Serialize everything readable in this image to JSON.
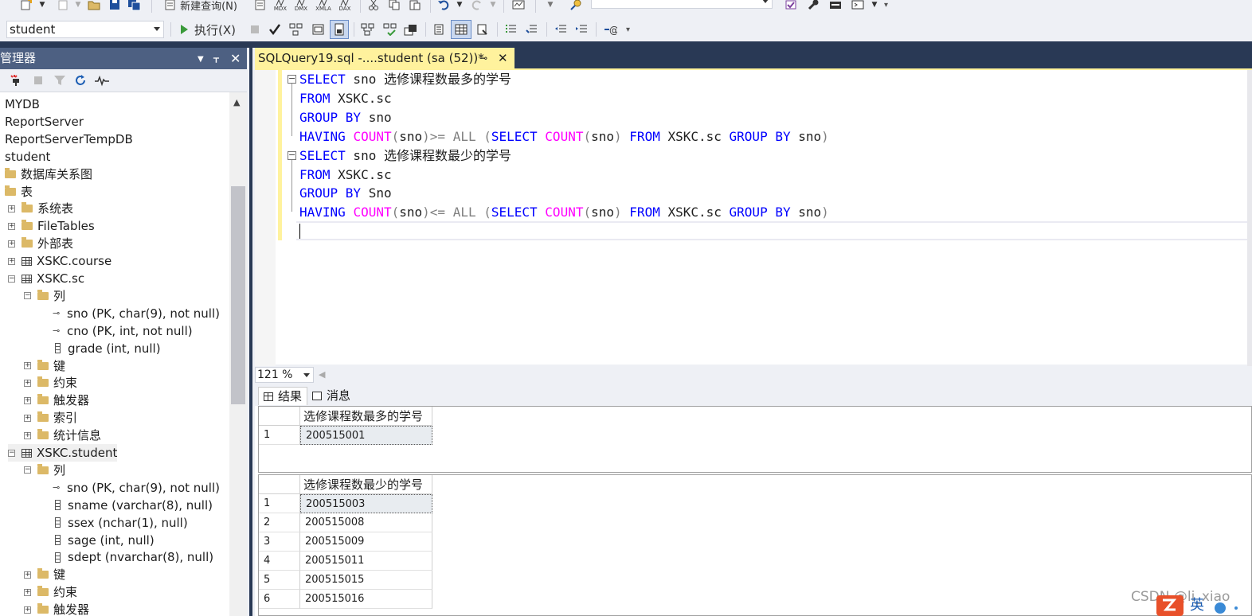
{
  "toolbar1": {
    "new_query_label": "新建查询(N)",
    "mdx": "MDX",
    "dmx": "DMX",
    "xmla": "XMLA",
    "dax": "DAX"
  },
  "toolbar2": {
    "database": "student",
    "execute_label": "执行(X)"
  },
  "object_explorer": {
    "title": "管理器",
    "tree": [
      {
        "label": "MYDB"
      },
      {
        "label": "ReportServer"
      },
      {
        "label": "ReportServerTempDB"
      },
      {
        "label": "student"
      },
      {
        "label": "数据库关系图"
      },
      {
        "label": "表"
      },
      {
        "label": "系统表"
      },
      {
        "label": "FileTables"
      },
      {
        "label": "外部表"
      },
      {
        "label": "XSKC.course"
      },
      {
        "label": "XSKC.sc"
      },
      {
        "label": "列"
      },
      {
        "label": "sno (PK, char(9), not null)"
      },
      {
        "label": "cno (PK, int, not null)"
      },
      {
        "label": "grade (int, null)"
      },
      {
        "label": "键"
      },
      {
        "label": "约束"
      },
      {
        "label": "触发器"
      },
      {
        "label": "索引"
      },
      {
        "label": "统计信息"
      },
      {
        "label": "XSKC.student"
      },
      {
        "label": "列"
      },
      {
        "label": "sno (PK, char(9), not null)"
      },
      {
        "label": "sname (varchar(8), null)"
      },
      {
        "label": "ssex (nchar(1), null)"
      },
      {
        "label": "sage (int, null)"
      },
      {
        "label": "sdept (nvarchar(8), null)"
      },
      {
        "label": "键"
      },
      {
        "label": "约束"
      },
      {
        "label": "触发器"
      }
    ]
  },
  "editor": {
    "tab_title": "SQLQuery19.sql -....student (sa (52))*",
    "lines": [
      [
        {
          "t": "SELECT",
          "c": "kw"
        },
        {
          "t": " sno 选修课程数最多的学号",
          "c": ""
        }
      ],
      [
        {
          "t": "FROM",
          "c": "kw"
        },
        {
          "t": " XSKC.sc",
          "c": ""
        }
      ],
      [
        {
          "t": "GROUP BY",
          "c": "kw"
        },
        {
          "t": " sno",
          "c": ""
        }
      ],
      [
        {
          "t": "HAVING",
          "c": "kw"
        },
        {
          "t": " ",
          "c": ""
        },
        {
          "t": "COUNT",
          "c": "fn"
        },
        {
          "t": "(",
          "c": "gr"
        },
        {
          "t": "sno",
          "c": ""
        },
        {
          "t": ")>= ALL (",
          "c": "gr"
        },
        {
          "t": "SELECT",
          "c": "kw"
        },
        {
          "t": " ",
          "c": ""
        },
        {
          "t": "COUNT",
          "c": "fn"
        },
        {
          "t": "(",
          "c": "gr"
        },
        {
          "t": "sno",
          "c": ""
        },
        {
          "t": ")",
          "c": "gr"
        },
        {
          "t": " ",
          "c": ""
        },
        {
          "t": "FROM",
          "c": "kw"
        },
        {
          "t": " XSKC.sc ",
          "c": ""
        },
        {
          "t": "GROUP BY",
          "c": "kw"
        },
        {
          "t": " sno",
          "c": ""
        },
        {
          "t": ")",
          "c": "gr"
        }
      ],
      [
        {
          "t": "SELECT",
          "c": "kw"
        },
        {
          "t": " sno 选修课程数最少的学号",
          "c": ""
        }
      ],
      [
        {
          "t": "FROM",
          "c": "kw"
        },
        {
          "t": " XSKC.sc",
          "c": ""
        }
      ],
      [
        {
          "t": "GROUP BY",
          "c": "kw"
        },
        {
          "t": " Sno",
          "c": ""
        }
      ],
      [
        {
          "t": "HAVING",
          "c": "kw"
        },
        {
          "t": " ",
          "c": ""
        },
        {
          "t": "COUNT",
          "c": "fn"
        },
        {
          "t": "(",
          "c": "gr"
        },
        {
          "t": "sno",
          "c": ""
        },
        {
          "t": ")<= ALL (",
          "c": "gr"
        },
        {
          "t": "SELECT",
          "c": "kw"
        },
        {
          "t": " ",
          "c": ""
        },
        {
          "t": "COUNT",
          "c": "fn"
        },
        {
          "t": "(",
          "c": "gr"
        },
        {
          "t": "sno",
          "c": ""
        },
        {
          "t": ")",
          "c": "gr"
        },
        {
          "t": " ",
          "c": ""
        },
        {
          "t": "FROM",
          "c": "kw"
        },
        {
          "t": " XSKC.sc ",
          "c": ""
        },
        {
          "t": "GROUP BY",
          "c": "kw"
        },
        {
          "t": " sno",
          "c": ""
        },
        {
          "t": ")",
          "c": "gr"
        }
      ]
    ],
    "zoom": "121 %"
  },
  "results": {
    "tab_results": "结果",
    "tab_messages": "消息",
    "grid1": {
      "header": "选修课程数最多的学号",
      "rows": [
        {
          "n": "1",
          "v": "200515001"
        }
      ]
    },
    "grid2": {
      "header": "选修课程数最少的学号",
      "rows": [
        {
          "n": "1",
          "v": "200515003"
        },
        {
          "n": "2",
          "v": "200515008"
        },
        {
          "n": "3",
          "v": "200515009"
        },
        {
          "n": "4",
          "v": "200515011"
        },
        {
          "n": "5",
          "v": "200515015"
        },
        {
          "n": "6",
          "v": "200515016"
        }
      ]
    }
  },
  "watermark": "CSDN @li_xiao",
  "ime": "英"
}
